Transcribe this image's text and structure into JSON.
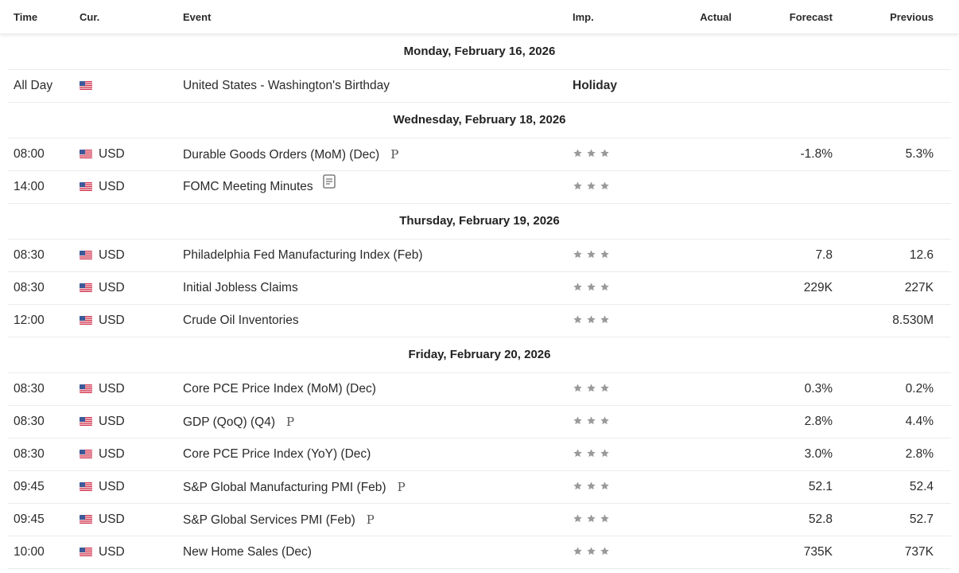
{
  "header": {
    "time": "Time",
    "currency": "Cur.",
    "event": "Event",
    "importance": "Imp.",
    "actual": "Actual",
    "forecast": "Forecast",
    "previous": "Previous"
  },
  "colors": {
    "star": "#9a9a9a",
    "divider": "#ececec"
  },
  "days": [
    {
      "date": "Monday, February 16, 2026",
      "events": [
        {
          "time": "All Day",
          "flag": "us-flag-icon",
          "currency": "",
          "event": "United States - Washington's Birthday",
          "holiday": "Holiday",
          "marker": "",
          "stars": 0,
          "actual": "",
          "forecast": "",
          "previous": ""
        }
      ]
    },
    {
      "date": "Wednesday, February 18, 2026",
      "events": [
        {
          "time": "08:00",
          "flag": "us-flag-icon",
          "currency": "USD",
          "event": "Durable Goods Orders (MoM) (Dec)",
          "marker": "P",
          "stars": 3,
          "actual": "",
          "forecast": "-1.8%",
          "previous": "5.3%"
        },
        {
          "time": "14:00",
          "flag": "us-flag-icon",
          "currency": "USD",
          "event": "FOMC Meeting Minutes",
          "marker": "doc",
          "stars": 3,
          "actual": "",
          "forecast": "",
          "previous": ""
        }
      ]
    },
    {
      "date": "Thursday, February 19, 2026",
      "events": [
        {
          "time": "08:30",
          "flag": "us-flag-icon",
          "currency": "USD",
          "event": "Philadelphia Fed Manufacturing Index (Feb)",
          "marker": "",
          "stars": 3,
          "actual": "",
          "forecast": "7.8",
          "previous": "12.6"
        },
        {
          "time": "08:30",
          "flag": "us-flag-icon",
          "currency": "USD",
          "event": "Initial Jobless Claims",
          "marker": "",
          "stars": 3,
          "actual": "",
          "forecast": "229K",
          "previous": "227K"
        },
        {
          "time": "12:00",
          "flag": "us-flag-icon",
          "currency": "USD",
          "event": "Crude Oil Inventories",
          "marker": "",
          "stars": 3,
          "actual": "",
          "forecast": "",
          "previous": "8.530M"
        }
      ]
    },
    {
      "date": "Friday, February 20, 2026",
      "events": [
        {
          "time": "08:30",
          "flag": "us-flag-icon",
          "currency": "USD",
          "event": "Core PCE Price Index (MoM) (Dec)",
          "marker": "",
          "stars": 3,
          "actual": "",
          "forecast": "0.3%",
          "previous": "0.2%"
        },
        {
          "time": "08:30",
          "flag": "us-flag-icon",
          "currency": "USD",
          "event": "GDP (QoQ) (Q4)",
          "marker": "P",
          "stars": 3,
          "actual": "",
          "forecast": "2.8%",
          "previous": "4.4%"
        },
        {
          "time": "08:30",
          "flag": "us-flag-icon",
          "currency": "USD",
          "event": "Core PCE Price Index (YoY) (Dec)",
          "marker": "",
          "stars": 3,
          "actual": "",
          "forecast": "3.0%",
          "previous": "2.8%"
        },
        {
          "time": "09:45",
          "flag": "us-flag-icon",
          "currency": "USD",
          "event": "S&P Global Manufacturing PMI (Feb)",
          "marker": "P",
          "stars": 3,
          "actual": "",
          "forecast": "52.1",
          "previous": "52.4"
        },
        {
          "time": "09:45",
          "flag": "us-flag-icon",
          "currency": "USD",
          "event": "S&P Global Services PMI (Feb)",
          "marker": "P",
          "stars": 3,
          "actual": "",
          "forecast": "52.8",
          "previous": "52.7"
        },
        {
          "time": "10:00",
          "flag": "us-flag-icon",
          "currency": "USD",
          "event": "New Home Sales (Dec)",
          "marker": "",
          "stars": 3,
          "actual": "",
          "forecast": "735K",
          "previous": "737K"
        }
      ]
    }
  ]
}
